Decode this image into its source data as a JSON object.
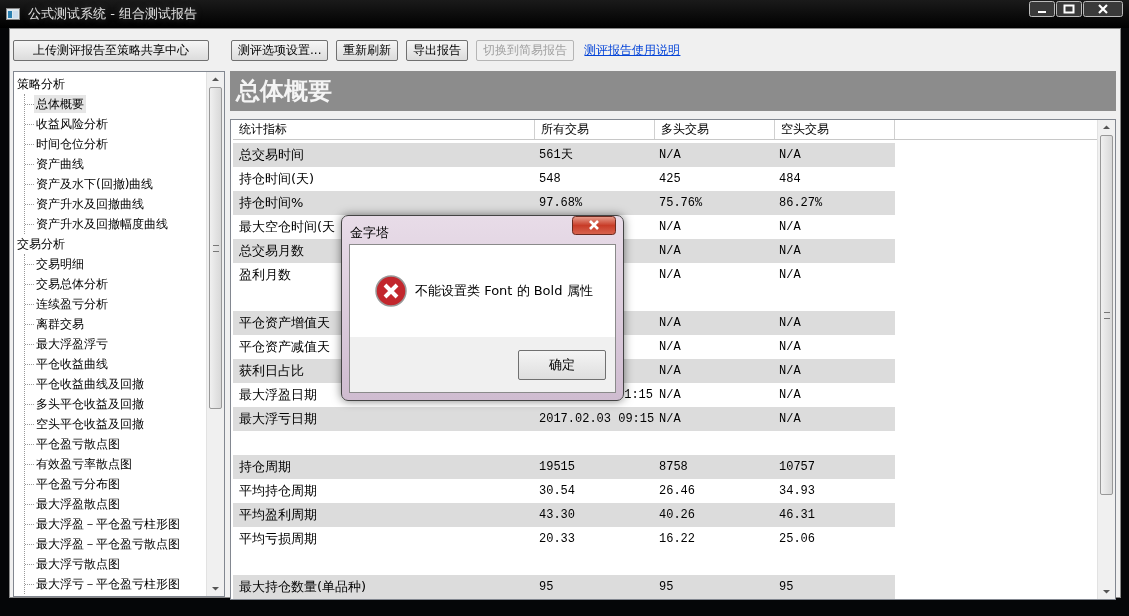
{
  "window": {
    "title": "公式测试系统 - 组合测试报告"
  },
  "toolbar": [
    {
      "kind": "button",
      "label": "上传测评报告至策略共享中心",
      "disabled": false
    },
    {
      "kind": "button",
      "label": "测评选项设置...",
      "disabled": false
    },
    {
      "kind": "button",
      "label": "重新刷新",
      "disabled": false
    },
    {
      "kind": "button",
      "label": "导出报告",
      "disabled": false
    },
    {
      "kind": "button",
      "label": "切换到简易报告",
      "disabled": true
    },
    {
      "kind": "link",
      "label": "测评报告使用说明",
      "disabled": false
    }
  ],
  "sidebar": {
    "items": [
      {
        "label": "策略分析",
        "selected": false,
        "children": [
          {
            "label": "总体概要",
            "selected": true
          },
          {
            "label": "收益风险分析",
            "selected": false
          },
          {
            "label": "时间仓位分析",
            "selected": false
          },
          {
            "label": "资产曲线",
            "selected": false
          },
          {
            "label": "资产及水下(回撤)曲线",
            "selected": false
          },
          {
            "label": "资产升水及回撤曲线",
            "selected": false
          },
          {
            "label": "资产升水及回撤幅度曲线",
            "selected": false
          }
        ]
      },
      {
        "label": "交易分析",
        "selected": false,
        "children": [
          {
            "label": "交易明细",
            "selected": false
          },
          {
            "label": "交易总体分析",
            "selected": false
          },
          {
            "label": "连续盈亏分析",
            "selected": false
          },
          {
            "label": "离群交易",
            "selected": false
          },
          {
            "label": "最大浮盈浮亏",
            "selected": false
          },
          {
            "label": "平仓收益曲线",
            "selected": false
          },
          {
            "label": "平仓收益曲线及回撤",
            "selected": false
          },
          {
            "label": "多头平仓收益及回撤",
            "selected": false
          },
          {
            "label": "空头平仓收益及回撤",
            "selected": false
          },
          {
            "label": "平仓盈亏散点图",
            "selected": false
          },
          {
            "label": "有效盈亏率散点图",
            "selected": false
          },
          {
            "label": "平仓盈亏分布图",
            "selected": false
          },
          {
            "label": "最大浮盈散点图",
            "selected": false
          },
          {
            "label": "最大浮盈－平仓盈亏柱形图",
            "selected": false
          },
          {
            "label": "最大浮盈－平仓盈亏散点图",
            "selected": false
          },
          {
            "label": "最大浮亏散点图",
            "selected": false
          },
          {
            "label": "最大浮亏－平仓盈亏柱形图",
            "selected": false
          }
        ]
      }
    ]
  },
  "section_title": "总体概要",
  "table": {
    "columns": [
      "统计指标",
      "所有交易",
      "多头交易",
      "空头交易"
    ],
    "rows": [
      {
        "kind": "data",
        "shaded": true,
        "cells": [
          "总交易时间",
          "561天",
          "N/A",
          "N/A"
        ]
      },
      {
        "kind": "data",
        "shaded": false,
        "cells": [
          "持仓时间(天)",
          "548",
          "425",
          "484"
        ]
      },
      {
        "kind": "data",
        "shaded": true,
        "cells": [
          "持仓时间%",
          "97.68%",
          "75.76%",
          "86.27%"
        ]
      },
      {
        "kind": "data",
        "shaded": false,
        "cells": [
          "最大空仓时间(天",
          "",
          "N/A",
          "N/A"
        ]
      },
      {
        "kind": "data",
        "shaded": true,
        "cells": [
          "总交易月数",
          "",
          "N/A",
          "N/A"
        ]
      },
      {
        "kind": "data",
        "shaded": false,
        "cells": [
          "盈利月数",
          "",
          "N/A",
          "N/A"
        ]
      },
      {
        "kind": "spacer",
        "shaded": false
      },
      {
        "kind": "data",
        "shaded": true,
        "cells": [
          "平仓资产增值天",
          "",
          "N/A",
          "N/A"
        ]
      },
      {
        "kind": "data",
        "shaded": false,
        "cells": [
          "平仓资产减值天",
          "",
          "N/A",
          "N/A"
        ]
      },
      {
        "kind": "data",
        "shaded": true,
        "cells": [
          "获利日占比",
          "",
          "N/A",
          "N/A"
        ]
      },
      {
        "kind": "data",
        "shaded": false,
        "cells": [
          "最大浮盈日期",
          "1:15",
          "N/A",
          "N/A"
        ],
        "cut_start": true
      },
      {
        "kind": "data",
        "shaded": true,
        "cells": [
          "最大浮亏日期",
          "2017.02.03 09:15",
          "N/A",
          "N/A"
        ]
      },
      {
        "kind": "spacer",
        "shaded": false
      },
      {
        "kind": "data",
        "shaded": true,
        "cells": [
          "持仓周期",
          "19515",
          "8758",
          "10757"
        ]
      },
      {
        "kind": "data",
        "shaded": false,
        "cells": [
          "平均持仓周期",
          "30.54",
          "26.46",
          "34.93"
        ]
      },
      {
        "kind": "data",
        "shaded": true,
        "cells": [
          "平均盈利周期",
          "43.30",
          "40.26",
          "46.31"
        ]
      },
      {
        "kind": "data",
        "shaded": false,
        "cells": [
          "平均亏损周期",
          "20.33",
          "16.22",
          "25.06"
        ]
      },
      {
        "kind": "spacer",
        "shaded": false
      },
      {
        "kind": "data",
        "shaded": true,
        "cells": [
          "最大持仓数量(单品种)",
          "95",
          "95",
          "95"
        ]
      }
    ]
  },
  "dialog": {
    "title": "金字塔",
    "message": "不能设置类 Font 的 Bold 属性",
    "button": "确定"
  }
}
